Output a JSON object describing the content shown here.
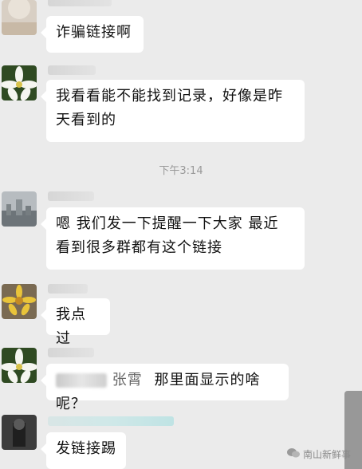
{
  "messages": [
    {
      "text": "诈骗链接啊"
    },
    {
      "text_line1": "我看看能不能找到记录，好像是昨",
      "text_line2": "天看到的"
    },
    {
      "text_line1": "嗯  我们发一下提醒一下大家  最近",
      "text_line2": "看到很多群都有这个链接"
    },
    {
      "text": "我点过"
    },
    {
      "text_partial": "张霄",
      "text": "那里面显示的啥呢？"
    },
    {
      "text": "发链接踢"
    }
  ],
  "timestamp": "下午3:14",
  "watermark": {
    "text": "南山新鲜事"
  }
}
